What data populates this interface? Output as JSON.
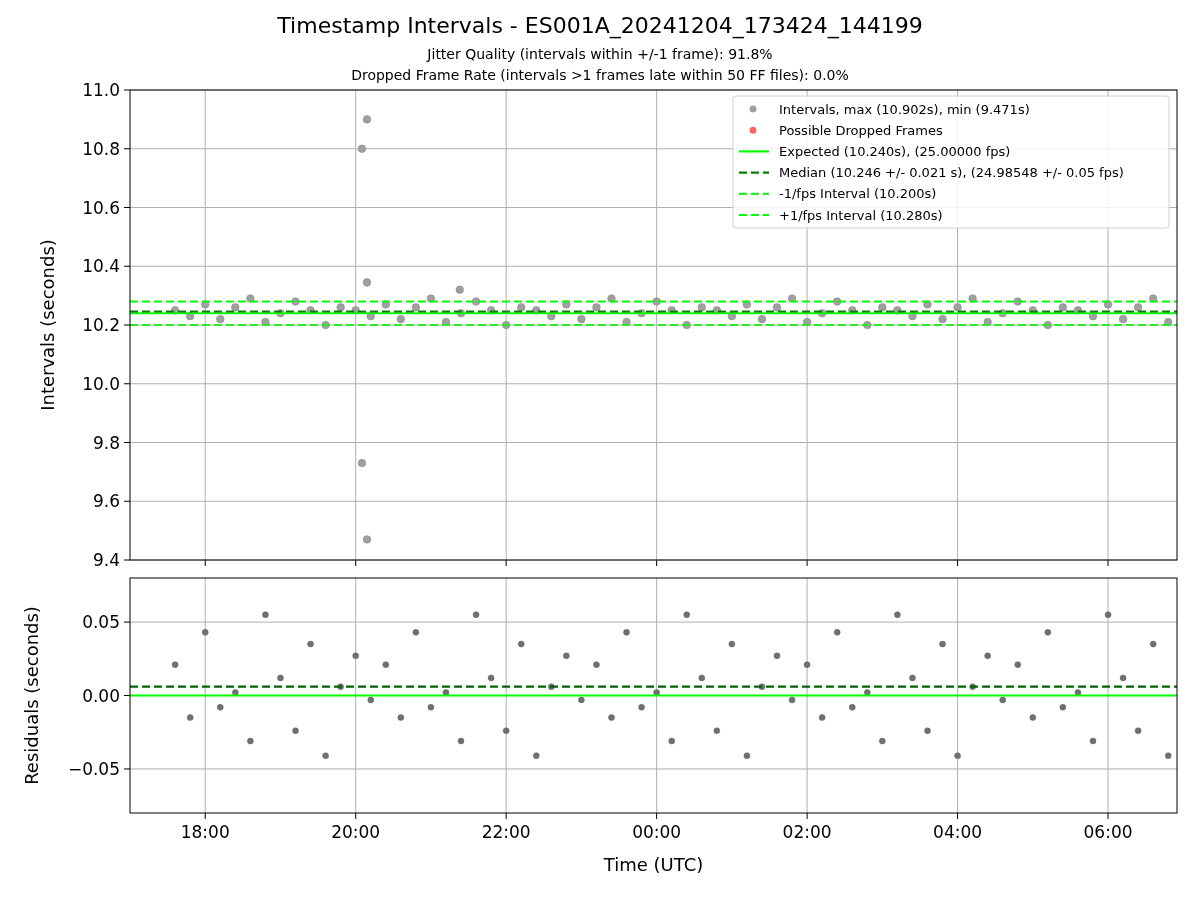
{
  "figure": {
    "title": "Timestamp Intervals - ES001A_20241204_173424_144199",
    "subtitles": [
      "Jitter Quality (intervals within +/-1 frame): 91.8%",
      "Dropped Frame Rate (intervals >1 frames late within 50 FF files): 0.0%"
    ]
  },
  "interval_plot": {
    "chart_data": {
      "type": "scatter",
      "ylabel": "Intervals (seconds)",
      "grid": true,
      "legend": true,
      "xlim": [
        "2024-12-04T17:00",
        "2024-12-05T06:55"
      ],
      "ylim": [
        9.4,
        11.0
      ],
      "yticks": [
        {
          "value": 9.4,
          "label": "9.4"
        },
        {
          "value": 9.6,
          "label": "9.6"
        },
        {
          "value": 9.8,
          "label": "9.8"
        },
        {
          "value": 10.0,
          "label": "10.0"
        },
        {
          "value": 10.2,
          "label": "10.2"
        },
        {
          "value": 10.4,
          "label": "10.4"
        },
        {
          "value": 10.6,
          "label": "10.6"
        },
        {
          "value": 10.8,
          "label": "10.8"
        },
        {
          "value": 11.0,
          "label": "11.0"
        }
      ],
      "series": [
        {
          "name": "Intervals, max (10.902s), min (9.471s)",
          "color": "#a0a0a0",
          "x": [
            "2024-12-04T17:36",
            "2024-12-04T17:48",
            "2024-12-04T18:00",
            "2024-12-04T18:12",
            "2024-12-04T18:24",
            "2024-12-04T18:36",
            "2024-12-04T18:48",
            "2024-12-04T19:00",
            "2024-12-04T19:12",
            "2024-12-04T19:24",
            "2024-12-04T19:36",
            "2024-12-04T19:48",
            "2024-12-04T20:00",
            "2024-12-04T20:12",
            "2024-12-04T20:24",
            "2024-12-04T20:36",
            "2024-12-04T20:48",
            "2024-12-04T21:00",
            "2024-12-04T21:12",
            "2024-12-04T21:24",
            "2024-12-04T21:36",
            "2024-12-04T21:48",
            "2024-12-04T22:00",
            "2024-12-04T22:12",
            "2024-12-04T22:24",
            "2024-12-04T22:36",
            "2024-12-04T22:48",
            "2024-12-04T23:00",
            "2024-12-04T23:12",
            "2024-12-04T23:24",
            "2024-12-04T23:36",
            "2024-12-04T23:48",
            "2024-12-05T00:00",
            "2024-12-05T00:12",
            "2024-12-05T00:24",
            "2024-12-05T00:36",
            "2024-12-05T00:48",
            "2024-12-05T01:00",
            "2024-12-05T01:12",
            "2024-12-05T01:24",
            "2024-12-05T01:36",
            "2024-12-05T01:48",
            "2024-12-05T02:00",
            "2024-12-05T02:12",
            "2024-12-05T02:24",
            "2024-12-05T02:36",
            "2024-12-05T02:48",
            "2024-12-05T03:00",
            "2024-12-05T03:12",
            "2024-12-05T03:24",
            "2024-12-05T03:36",
            "2024-12-05T03:48",
            "2024-12-05T04:00",
            "2024-12-05T04:12",
            "2024-12-05T04:24",
            "2024-12-05T04:36",
            "2024-12-05T04:48",
            "2024-12-05T05:00",
            "2024-12-05T05:12",
            "2024-12-05T05:24",
            "2024-12-05T05:36",
            "2024-12-05T05:48",
            "2024-12-05T06:00",
            "2024-12-05T06:12",
            "2024-12-05T06:24",
            "2024-12-05T06:36",
            "2024-12-05T06:48",
            "2024-12-04T20:05",
            "2024-12-04T20:09",
            "2024-12-04T20:09",
            "2024-12-04T20:05",
            "2024-12-04T20:09",
            "2024-12-04T21:23"
          ],
          "values": [
            10.25,
            10.23,
            10.27,
            10.22,
            10.26,
            10.29,
            10.21,
            10.24,
            10.28,
            10.25,
            10.2,
            10.26,
            10.25,
            10.23,
            10.27,
            10.22,
            10.26,
            10.29,
            10.21,
            10.24,
            10.28,
            10.25,
            10.2,
            10.26,
            10.25,
            10.23,
            10.27,
            10.22,
            10.26,
            10.29,
            10.21,
            10.24,
            10.28,
            10.25,
            10.2,
            10.26,
            10.25,
            10.23,
            10.27,
            10.22,
            10.26,
            10.29,
            10.21,
            10.24,
            10.28,
            10.25,
            10.2,
            10.26,
            10.25,
            10.23,
            10.27,
            10.22,
            10.26,
            10.29,
            10.21,
            10.24,
            10.28,
            10.25,
            10.2,
            10.26,
            10.25,
            10.23,
            10.27,
            10.22,
            10.26,
            10.29,
            10.21,
            10.8,
            10.9,
            10.345,
            9.73,
            9.47,
            10.32
          ]
        },
        {
          "name": "Possible Dropped Frames",
          "color": "#ff6666"
        }
      ],
      "ref_lines": [
        {
          "axis": "y",
          "value": 10.24,
          "label": "Expected (10.240s), (25.00000 fps)",
          "color": "#00ff00"
        },
        {
          "axis": "y",
          "value": 10.246,
          "label": "Median (10.246 +/- 0.021 s), (24.98548 +/- 0.05 fps)",
          "color": "#008000"
        },
        {
          "axis": "y",
          "value": 10.2,
          "label": "-1/fps Interval (10.200s)",
          "color": "#22ee22"
        },
        {
          "axis": "y",
          "value": 10.28,
          "label": "+1/fps Interval (10.280s)",
          "color": "#00ff00"
        }
      ]
    }
  },
  "residual_plot": {
    "chart_data": {
      "type": "scatter",
      "xlabel": "Time (UTC)",
      "ylabel": "Residuals (seconds)",
      "grid": true,
      "xlim": [
        "2024-12-04T17:00",
        "2024-12-05T06:55"
      ],
      "ylim": [
        -0.08,
        0.08
      ],
      "xticks": [
        {
          "value": "2024-12-04T18:00",
          "label": "18:00"
        },
        {
          "value": "2024-12-04T20:00",
          "label": "20:00"
        },
        {
          "value": "2024-12-04T22:00",
          "label": "22:00"
        },
        {
          "value": "2024-12-05T00:00",
          "label": "00:00"
        },
        {
          "value": "2024-12-05T02:00",
          "label": "02:00"
        },
        {
          "value": "2024-12-05T04:00",
          "label": "04:00"
        },
        {
          "value": "2024-12-05T06:00",
          "label": "06:00"
        }
      ],
      "yticks": [
        {
          "value": -0.05,
          "label": "−0.05"
        },
        {
          "value": 0,
          "label": "0.00"
        },
        {
          "value": 0.05,
          "label": "0.05"
        }
      ],
      "series": [
        {
          "color": "#707070",
          "x": [
            "2024-12-04T17:36",
            "2024-12-04T17:48",
            "2024-12-04T18:00",
            "2024-12-04T18:12",
            "2024-12-04T18:24",
            "2024-12-04T18:36",
            "2024-12-04T18:48",
            "2024-12-04T19:00",
            "2024-12-04T19:12",
            "2024-12-04T19:24",
            "2024-12-04T19:36",
            "2024-12-04T19:48",
            "2024-12-04T20:00",
            "2024-12-04T20:12",
            "2024-12-04T20:24",
            "2024-12-04T20:36",
            "2024-12-04T20:48",
            "2024-12-04T21:00",
            "2024-12-04T21:12",
            "2024-12-04T21:24",
            "2024-12-04T21:36",
            "2024-12-04T21:48",
            "2024-12-04T22:00",
            "2024-12-04T22:12",
            "2024-12-04T22:24",
            "2024-12-04T22:36",
            "2024-12-04T22:48",
            "2024-12-04T23:00",
            "2024-12-04T23:12",
            "2024-12-04T23:24",
            "2024-12-04T23:36",
            "2024-12-04T23:48",
            "2024-12-05T00:00",
            "2024-12-05T00:12",
            "2024-12-05T00:24",
            "2024-12-05T00:36",
            "2024-12-05T00:48",
            "2024-12-05T01:00",
            "2024-12-05T01:12",
            "2024-12-05T01:24",
            "2024-12-05T01:36",
            "2024-12-05T01:48",
            "2024-12-05T02:00",
            "2024-12-05T02:12",
            "2024-12-05T02:24",
            "2024-12-05T02:36",
            "2024-12-05T02:48",
            "2024-12-05T03:00",
            "2024-12-05T03:12",
            "2024-12-05T03:24",
            "2024-12-05T03:36",
            "2024-12-05T03:48",
            "2024-12-05T04:00",
            "2024-12-05T04:12",
            "2024-12-05T04:24",
            "2024-12-05T04:36",
            "2024-12-05T04:48",
            "2024-12-05T05:00",
            "2024-12-05T05:12",
            "2024-12-05T05:24",
            "2024-12-05T05:36",
            "2024-12-05T05:48",
            "2024-12-05T06:00",
            "2024-12-05T06:12",
            "2024-12-05T06:24",
            "2024-12-05T06:36",
            "2024-12-05T06:48"
          ],
          "values": [
            0.021,
            -0.015,
            0.043,
            -0.008,
            0.002,
            -0.031,
            0.055,
            0.012,
            -0.024,
            0.035,
            -0.041,
            0.006,
            0.027,
            -0.003,
            0.021,
            -0.015,
            0.043,
            -0.008,
            0.002,
            -0.031,
            0.055,
            0.012,
            -0.024,
            0.035,
            -0.041,
            0.006,
            0.027,
            -0.003,
            0.021,
            -0.015,
            0.043,
            -0.008,
            0.002,
            -0.031,
            0.055,
            0.012,
            -0.024,
            0.035,
            -0.041,
            0.006,
            0.027,
            -0.003,
            0.021,
            -0.015,
            0.043,
            -0.008,
            0.002,
            -0.031,
            0.055,
            0.012,
            -0.024,
            0.035,
            -0.041,
            0.006,
            0.027,
            -0.003,
            0.021,
            -0.015,
            0.043,
            -0.008,
            0.002,
            -0.031,
            0.055,
            0.012,
            -0.024,
            0.035,
            -0.041
          ]
        }
      ],
      "ref_lines": [
        {
          "axis": "y",
          "value": 0,
          "color": "#00ff00"
        },
        {
          "axis": "y",
          "value": 0.006,
          "color": "#006400"
        }
      ]
    }
  }
}
